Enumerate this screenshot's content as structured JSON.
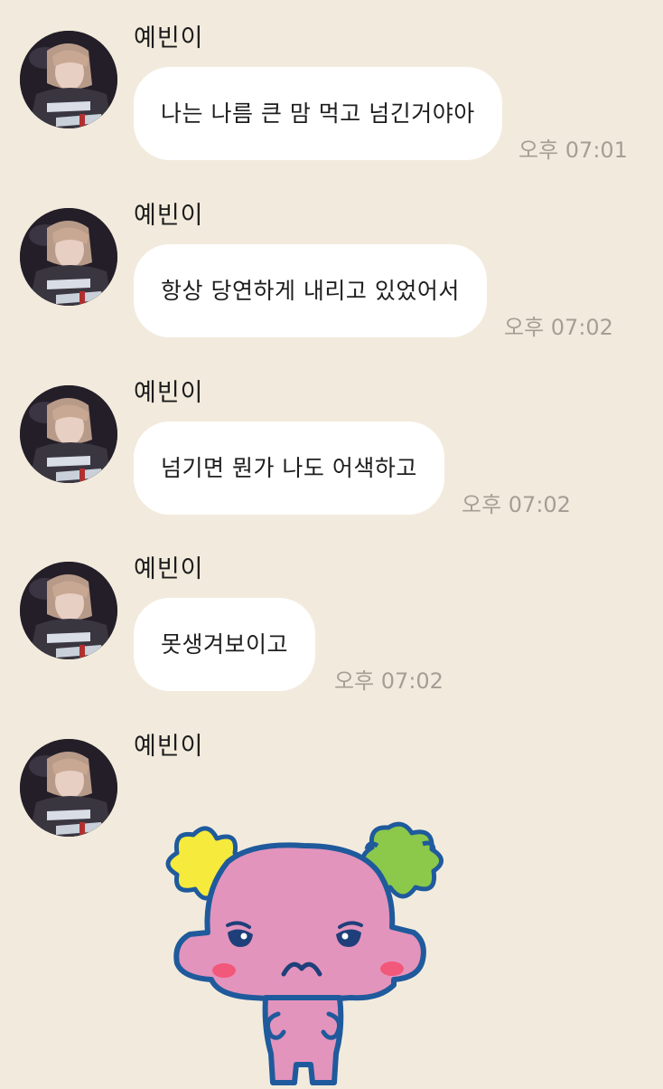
{
  "messages": [
    {
      "sender": "예빈이",
      "text": "나는 나름 큰 맘 먹고 넘긴거야아",
      "time": "오후 07:01"
    },
    {
      "sender": "예빈이",
      "text": "항상 당연하게 내리고 있었어서",
      "time": "오후 07:02"
    },
    {
      "sender": "예빈이",
      "text": "넘기면 뭔가 나도 어색하고",
      "time": "오후 07:02"
    },
    {
      "sender": "예빈이",
      "text": "못생겨보이고",
      "time": "오후 07:02"
    }
  ],
  "sticker_message": {
    "sender": "예빈이",
    "sticker": "pink-tamagotchi-character-sticker"
  },
  "colors": {
    "background": "#f2ebdd",
    "bubble": "#ffffff",
    "time_text": "#a59e95"
  }
}
